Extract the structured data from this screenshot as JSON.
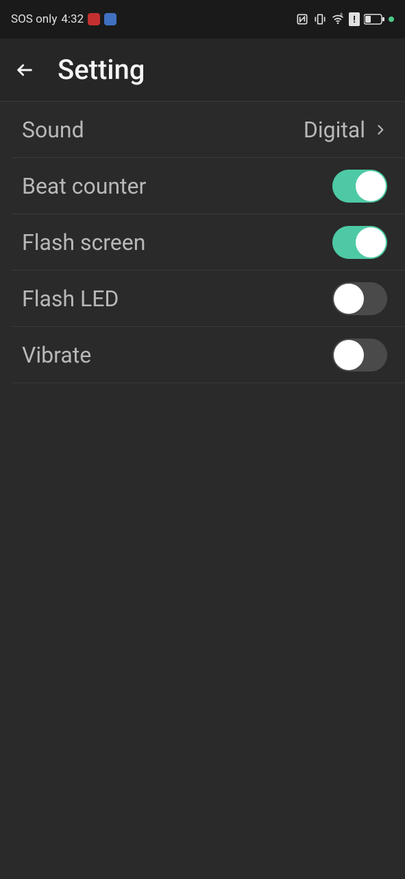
{
  "status_bar": {
    "network_text": "SOS only",
    "time": "4:32"
  },
  "header": {
    "title": "Setting"
  },
  "settings": {
    "sound": {
      "label": "Sound",
      "value": "Digital"
    },
    "beat_counter": {
      "label": "Beat counter",
      "enabled": true
    },
    "flash_screen": {
      "label": "Flash screen",
      "enabled": true
    },
    "flash_led": {
      "label": "Flash LED",
      "enabled": false
    },
    "vibrate": {
      "label": "Vibrate",
      "enabled": false
    }
  }
}
